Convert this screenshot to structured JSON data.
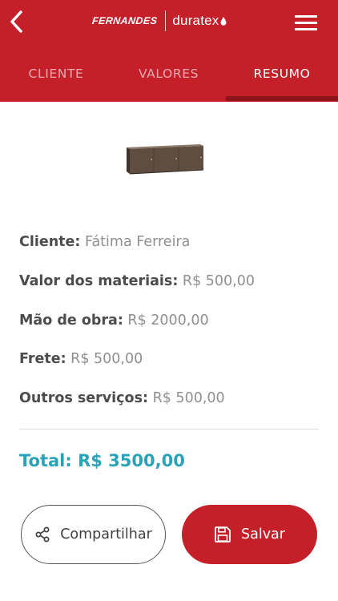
{
  "header": {
    "brand_primary": "FERNANDES",
    "brand_secondary": "duratex",
    "back_icon": "chevron-left-icon",
    "menu_icon": "hamburger-menu-icon",
    "color": "#c5202a"
  },
  "tabs": [
    {
      "label": "CLIENTE",
      "active": false
    },
    {
      "label": "VALORES",
      "active": false
    },
    {
      "label": "RESUMO",
      "active": true
    }
  ],
  "summary": {
    "cliente": {
      "label": "Cliente:",
      "value": "Fátima Ferreira"
    },
    "materiais": {
      "label": "Valor dos materiais:",
      "value": "R$ 500,00"
    },
    "mao_obra": {
      "label": "Mão de obra:",
      "value": "R$ 2000,00"
    },
    "frete": {
      "label": "Frete:",
      "value": "R$ 500,00"
    },
    "outros": {
      "label": "Outros serviços:",
      "value": "R$ 500,00"
    }
  },
  "total": "Total: R$ 3500,00",
  "actions": {
    "share": {
      "label": "Compartilhar",
      "icon": "share-icon"
    },
    "save": {
      "label": "Salvar",
      "icon": "floppy-disk-icon"
    }
  },
  "colors": {
    "accent": "#c5202a",
    "tab_indicator": "#8e141b",
    "total": "#2aa3b8"
  }
}
